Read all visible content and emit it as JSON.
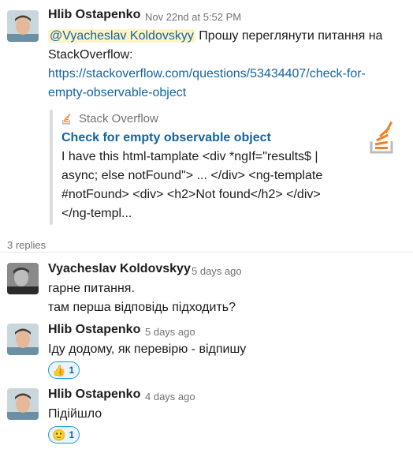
{
  "messages": [
    {
      "author": "Hlib Ostapenko",
      "time": "Nov 22nd at 5:52 PM",
      "mention": "@Vyacheslav Koldovskyy",
      "text_after_mention": " Прошу переглянути питання на",
      "text_line2": "StackOverflow:",
      "link_line1": "https://stackoverflow.com/questions/53434407/check-for-",
      "link_line2": "empty-observable-object"
    },
    {
      "author": "Vyacheslav Koldovskyy",
      "time": "5 days ago",
      "line1": "гарне питання.",
      "line2": "там перша відповідь підходить?"
    },
    {
      "author": "Hlib Ostapenko",
      "time": "5 days ago",
      "line1": "Іду додому, як перевірю - відпишу",
      "reaction": {
        "emoji_name": "thumbs-up",
        "count": "1"
      }
    },
    {
      "author": "Hlib Ostapenko",
      "time": "4 days ago",
      "line1": "Підійшло",
      "reaction": {
        "emoji_name": "slightly-smiling-face",
        "count": "1"
      }
    }
  ],
  "unfurl": {
    "source": "Stack Overflow",
    "title": "Check for empty observable object",
    "lines": [
      "I have this html-tamplate <div *ngIf=\"results$ |",
      "async; else notFound\"> ... </div> <ng-template",
      "#notFound> <div> <h2>Not found</h2> </div>",
      "</ng-templ..."
    ]
  },
  "thread": {
    "replies_label": "3 replies"
  },
  "colors": {
    "link": "#1264a3",
    "mention_bg": "#fef3c4",
    "reaction_border": "#1d9bd1",
    "so_orange": "#f48024"
  }
}
